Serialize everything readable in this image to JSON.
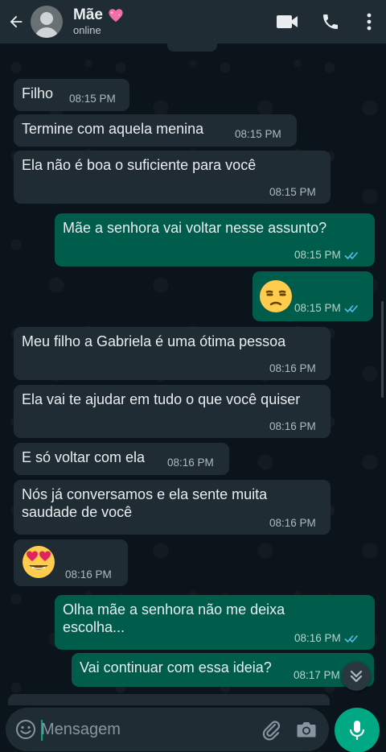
{
  "header": {
    "contact_name": "Mãe",
    "status": "online",
    "icons": {
      "back": "arrow-left-icon",
      "video": "video-call-icon",
      "call": "phone-icon",
      "more": "more-vert-icon",
      "name_emoji": "sparkling-heart-emoji"
    }
  },
  "messages": [
    {
      "dir": "in",
      "text": "Filho",
      "time": "08:15 PM"
    },
    {
      "dir": "in",
      "text": "Termine com aquela menina",
      "time": "08:15 PM"
    },
    {
      "dir": "in",
      "text": "Ela não é boa o suficiente para você",
      "time": "08:15 PM"
    },
    {
      "dir": "out",
      "text": "Mãe a senhora vai voltar nesse assunto?",
      "time": "08:15 PM",
      "read": true
    },
    {
      "dir": "out",
      "emoji": "unamused-face-emoji",
      "time": "08:15 PM",
      "read": true
    },
    {
      "dir": "in",
      "text": "Meu filho a Gabriela é uma ótima pessoa",
      "time": "08:16 PM"
    },
    {
      "dir": "in",
      "text": "Ela vai te ajudar em tudo o que você quiser",
      "time": "08:16 PM"
    },
    {
      "dir": "in",
      "text": "E só voltar com ela",
      "time": "08:16 PM"
    },
    {
      "dir": "in",
      "text": "Nós já conversamos e ela sente muita\nsaudade de você",
      "time": "08:16 PM"
    },
    {
      "dir": "in",
      "emoji": "heart-eyes-emoji",
      "time": "08:16 PM"
    },
    {
      "dir": "out",
      "text": "Olha mãe a senhora não me deixa\nescolha...",
      "time": "08:16 PM",
      "read": true
    },
    {
      "dir": "out",
      "text": "Vai continuar com essa ideia?",
      "time": "08:17 PM",
      "read": true
    }
  ],
  "composer": {
    "placeholder": "Mensagem",
    "icons": {
      "emoji": "emoji-smile-icon",
      "attach": "paperclip-icon",
      "camera": "camera-icon",
      "mic": "microphone-icon",
      "scroll_down": "chevron-double-down-icon"
    }
  },
  "colors": {
    "background": "#0b141a",
    "header": "#1f2c34",
    "incoming_bubble": "#202c33",
    "outgoing_bubble": "#005c4b",
    "accent": "#00a884",
    "read_tick": "#53bdeb"
  }
}
